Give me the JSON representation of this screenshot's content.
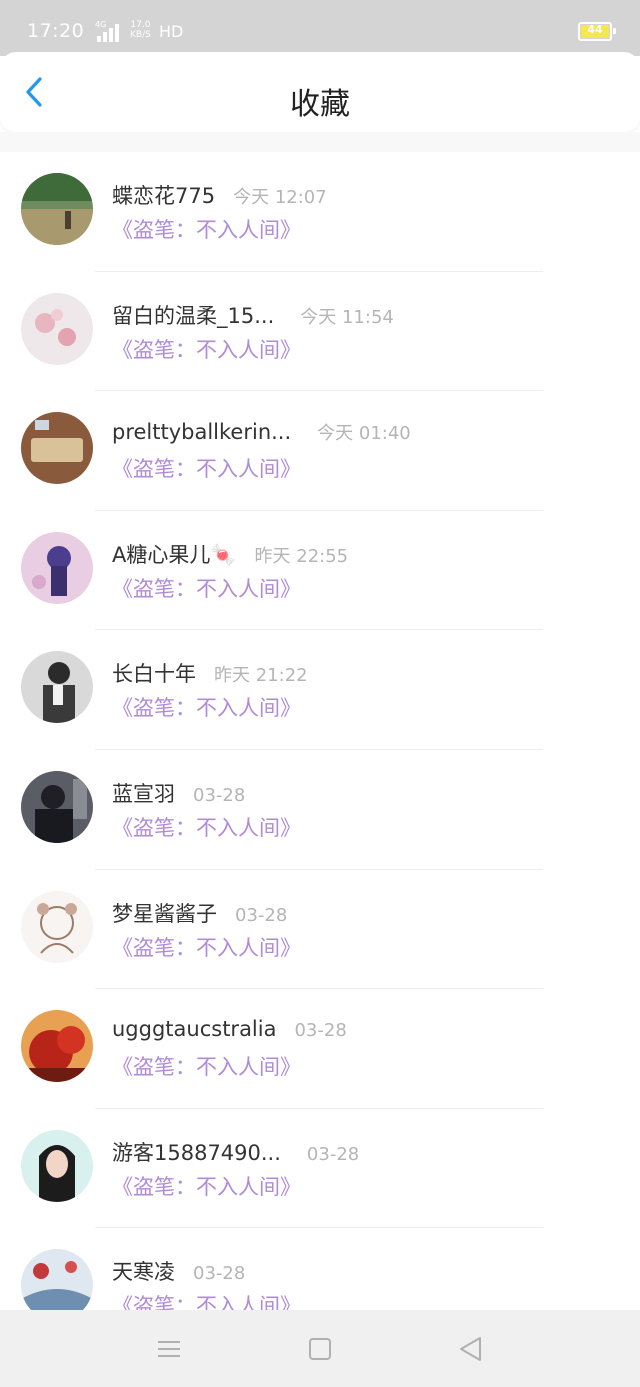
{
  "status_bar": {
    "time": "17:20",
    "network": "4G",
    "speed_top": "17.0",
    "speed_bottom": "KB/S",
    "hd": "HD",
    "battery": "44",
    "battery_color": "#f4e84a"
  },
  "header": {
    "title": "收藏",
    "back_icon": "chevron-left-icon",
    "accent": "#2196f3"
  },
  "items": [
    {
      "name": "蝶恋花775",
      "time": "今天 12:07",
      "book": "《盗笔：不入人间》"
    },
    {
      "name": "留白的温柔_15...",
      "time": "今天 11:54",
      "book": "《盗笔：不入人间》"
    },
    {
      "name": "prelttyballkerin...",
      "time": "今天 01:40",
      "book": "《盗笔：不入人间》"
    },
    {
      "name": "A糖心果儿🍬",
      "time": "昨天 22:55",
      "book": "《盗笔：不入人间》"
    },
    {
      "name": "长白十年",
      "time": "昨天 21:22",
      "book": "《盗笔：不入人间》"
    },
    {
      "name": "蓝宣羽",
      "time": "03-28",
      "book": "《盗笔：不入人间》"
    },
    {
      "name": "梦星酱酱子",
      "time": "03-28",
      "book": "《盗笔：不入人间》"
    },
    {
      "name": "ugggtaucstralia",
      "time": "03-28",
      "book": "《盗笔：不入人间》"
    },
    {
      "name": "游客15887490...",
      "time": "03-28",
      "book": "《盗笔：不入人间》"
    },
    {
      "name": "天寒凌",
      "time": "03-28",
      "book": "《盗笔：不入人间》"
    }
  ],
  "nav": {
    "menu_icon": "menu-icon",
    "home_icon": "square-home-icon",
    "back_icon": "triangle-back-icon"
  }
}
